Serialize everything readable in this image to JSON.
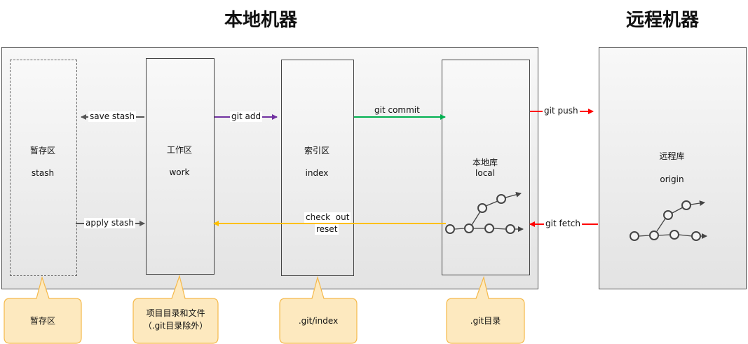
{
  "titles": {
    "local_machine": "本地机器",
    "remote_machine": "远程机器"
  },
  "areas": {
    "stash": {
      "name": "暂存区",
      "sub": "stash"
    },
    "work": {
      "name": "工作区",
      "sub": "work"
    },
    "index": {
      "name": "索引区",
      "sub": "index"
    },
    "local": {
      "name": "本地库",
      "sub": "local"
    },
    "origin": {
      "name": "远程库",
      "sub": "origin"
    }
  },
  "arrows": {
    "save_stash": "save stash",
    "apply_stash": "apply stash",
    "git_add": "git add",
    "git_commit": "git commit",
    "checkout": "check  out",
    "reset": "reset",
    "git_push": "git push",
    "git_fetch": "git fetch"
  },
  "callouts": {
    "stash": "暂存区",
    "work_line1": "项目目录和文件",
    "work_line2": "（.git目录除外）",
    "index": ".git/index",
    "local": ".git目录"
  },
  "colors": {
    "purple": "#7030a0",
    "green": "#00b050",
    "orange": "#ffc000",
    "red": "#ff0000",
    "gray": "#555555",
    "callout_fill": "#fde9bf",
    "callout_stroke": "#f5b94a"
  }
}
